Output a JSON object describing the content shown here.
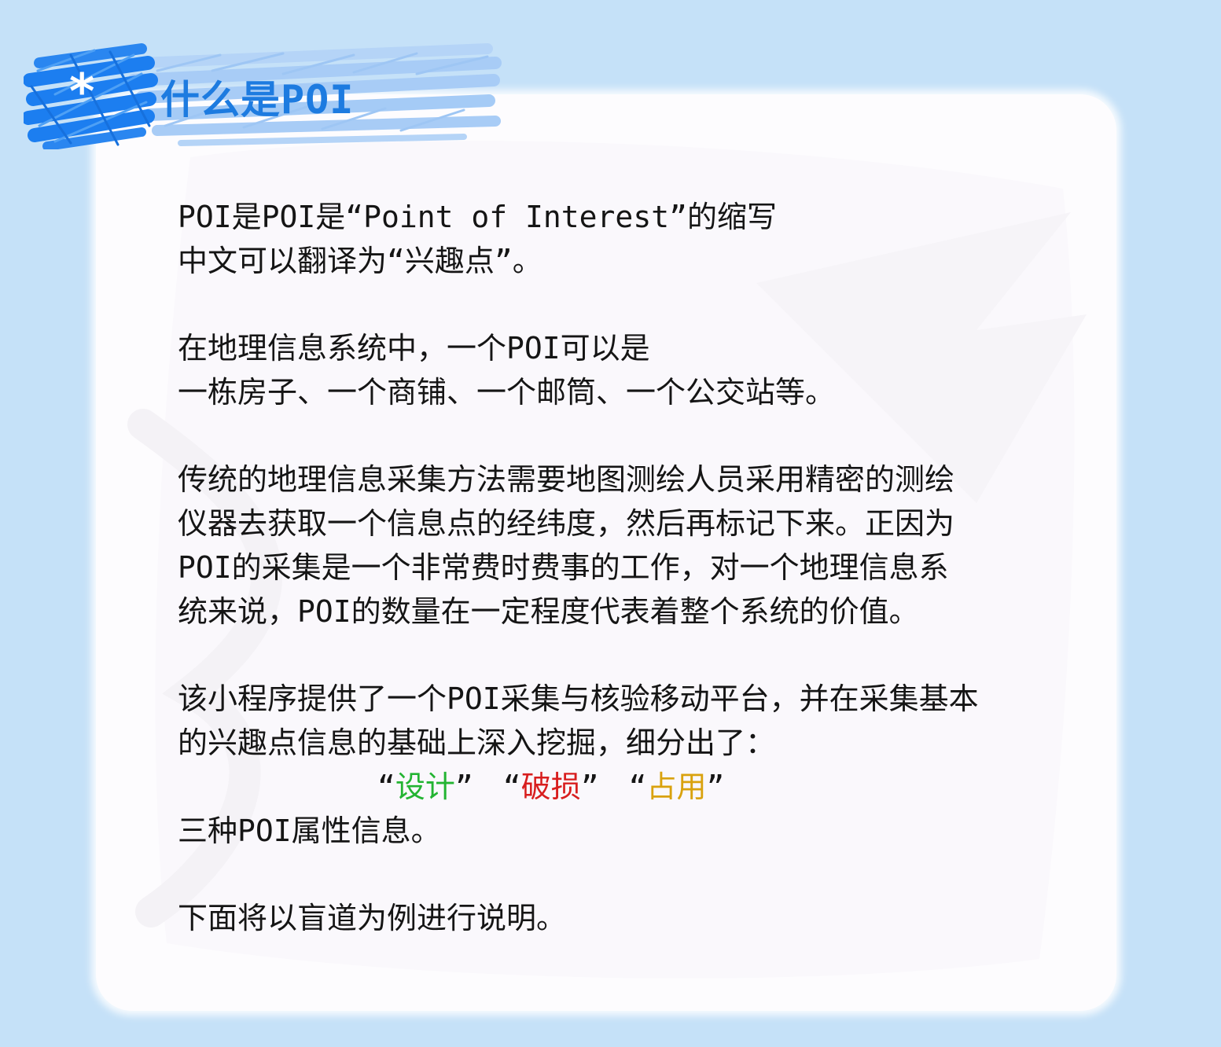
{
  "header": {
    "icon": "asterisk-icon",
    "asterisk_glyph": "*",
    "title": "什么是POI",
    "title_color": "#1d7be0",
    "scribble_colors": [
      "#1c7ef0",
      "#4ea0f5",
      "#a8ccf6"
    ]
  },
  "paragraphs": [
    {
      "lines": [
        "POI是POI是“Point of Interest”的缩写",
        "中文可以翻译为“兴趣点”。"
      ]
    },
    {
      "lines": [
        "在地理信息系统中，一个POI可以是",
        "一栋房子、一个商铺、一个邮筒、一个公交站等。"
      ]
    },
    {
      "lines": [
        "传统的地理信息采集方法需要地图测绘人员采用精密的测绘",
        "仪器去获取一个信息点的经纬度，然后再标记下来。正因为",
        "POI的采集是一个非常费时费事的工作，对一个地理信息系",
        "统来说，POI的数量在一定程度代表着整个系统的价值。"
      ]
    },
    {
      "lines": [
        "该小程序提供了一个POI采集与核验移动平台，并在采集基本",
        "的兴趣点信息的基础上深入挖掘，细分出了："
      ]
    }
  ],
  "attributes": {
    "open_quote": "“",
    "close_quote": "”",
    "items": [
      {
        "label": "设计",
        "color": "#23b432"
      },
      {
        "label": "破损",
        "color": "#d81e1e"
      },
      {
        "label": "占用",
        "color": "#d9a20e"
      }
    ],
    "suffix": "三种POI属性信息。"
  },
  "closing": "下面将以盲道为例进行说明。"
}
